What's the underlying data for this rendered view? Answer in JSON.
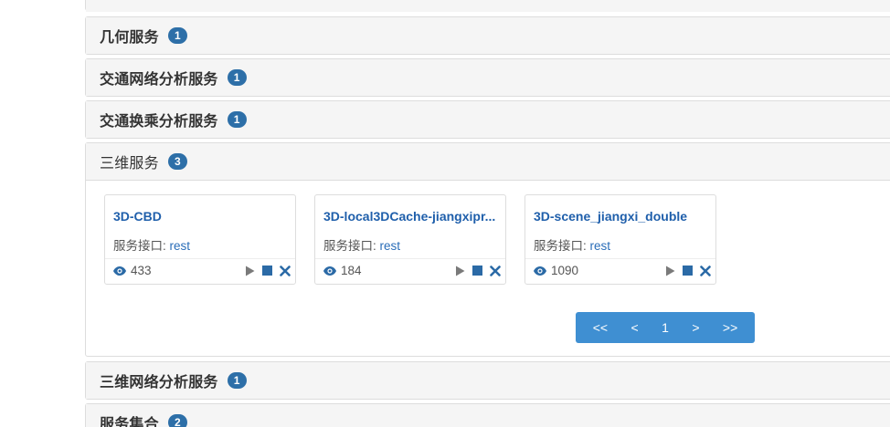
{
  "panels_top": [
    {
      "title": "几何服务",
      "count": "1"
    },
    {
      "title": "交通网络分析服务",
      "count": "1"
    },
    {
      "title": "交通换乘分析服务",
      "count": "1"
    }
  ],
  "expanded": {
    "title": "三维服务",
    "count": "3",
    "cards": [
      {
        "name": "3D-CBD",
        "iface_label": "服务接口:",
        "iface_value": "rest",
        "views": "433"
      },
      {
        "name": "3D-local3DCache-jiangxipr...",
        "iface_label": "服务接口:",
        "iface_value": "rest",
        "views": "184"
      },
      {
        "name": "3D-scene_jiangxi_double",
        "iface_label": "服务接口:",
        "iface_value": "rest",
        "views": "1090"
      }
    ],
    "pager": {
      "first": "<<",
      "prev": "<",
      "page": "1",
      "next": ">",
      "last": ">>"
    }
  },
  "panels_bottom": [
    {
      "title": "三维网络分析服务",
      "count": "1"
    },
    {
      "title": "服务集合",
      "count": "2"
    }
  ],
  "icons": {
    "views": "eye-icon",
    "play": "play-icon",
    "stop": "stop-icon",
    "delete": "close-icon"
  },
  "colors": {
    "badge": "#2d6fa8",
    "link": "#1f5fab",
    "pager": "#3f8fd2",
    "action": "#2b6aa6"
  }
}
